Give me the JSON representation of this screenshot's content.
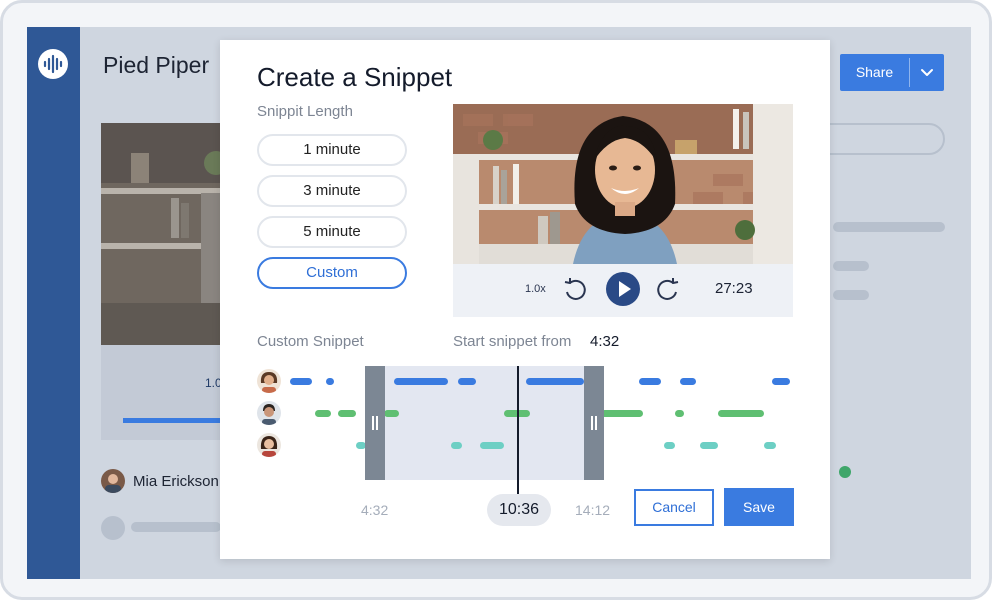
{
  "app": {
    "title": "Pied Piper",
    "share_label": "Share",
    "bg_speed": "1.0",
    "bg_user_name": "Mia Erickson"
  },
  "modal": {
    "title": "Create a Snippet",
    "length_label": "Snippit Length",
    "length_options": [
      {
        "label": "1 minute",
        "selected": false
      },
      {
        "label": "3 minute",
        "selected": false
      },
      {
        "label": "5 minute",
        "selected": false
      },
      {
        "label": "Custom",
        "selected": true
      }
    ],
    "player": {
      "speed": "1.0x",
      "time": "27:23"
    },
    "custom_label": "Custom Snippet",
    "start_label": "Start snippet from",
    "start_value": "4:32",
    "timeline": {
      "start": "4:32",
      "current": "10:36",
      "end": "14:12"
    },
    "cancel_label": "Cancel",
    "save_label": "Save"
  },
  "colors": {
    "accent": "#3a7be0",
    "speaker1": "#3a7be0",
    "speaker2": "#5fbf72",
    "speaker3": "#6dcfc4",
    "rail": "#2f5896"
  },
  "icons": [
    "logo-waveform-icon",
    "chevron-down-icon",
    "rewind-icon",
    "play-icon",
    "fast-forward-icon"
  ]
}
